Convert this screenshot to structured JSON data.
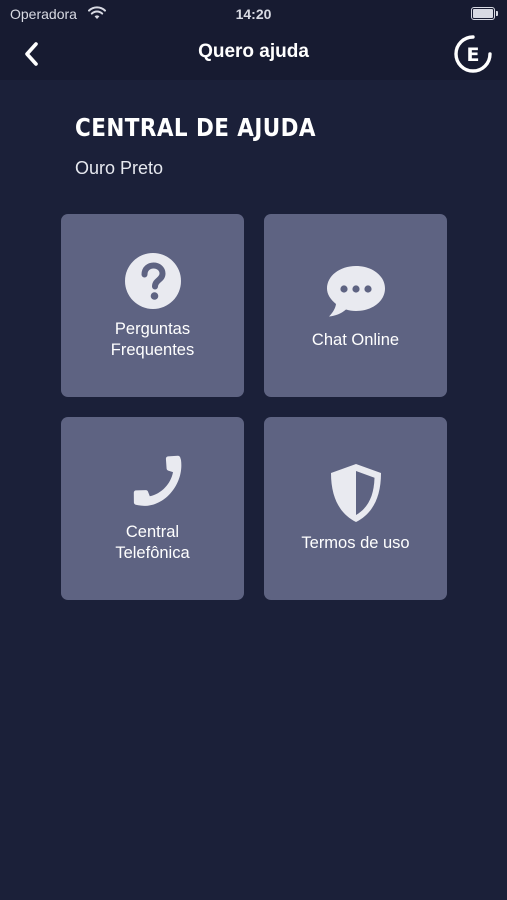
{
  "status_bar": {
    "carrier": "Operadora",
    "time": "14:20"
  },
  "nav": {
    "title": "Quero ajuda",
    "logo_letter": "E"
  },
  "header": {
    "title": "CENTRAL DE AJUDA",
    "subtitle": "Ouro Preto"
  },
  "tiles": [
    {
      "label": "Perguntas\nFrequentes",
      "icon": "question-circle-icon"
    },
    {
      "label": "Chat Online",
      "icon": "chat-bubble-icon"
    },
    {
      "label": "Central\nTelefônica",
      "icon": "phone-icon"
    },
    {
      "label": "Termos de uso",
      "icon": "shield-icon"
    }
  ],
  "colors": {
    "background": "#1b2039",
    "bar": "#171b31",
    "tile": "#5e6382",
    "icon": "#e9eaf0"
  }
}
